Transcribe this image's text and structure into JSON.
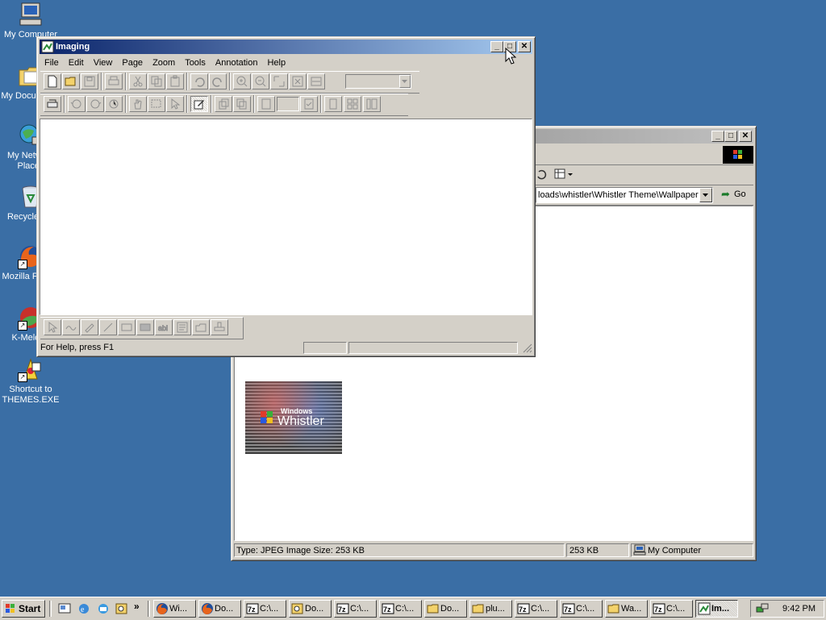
{
  "desktop": {
    "icons": [
      {
        "label": "My Computer"
      },
      {
        "label": "My Documents"
      },
      {
        "label": "My Network Places"
      },
      {
        "label": "Recycle Bin"
      },
      {
        "label": "Mozilla Firefox"
      },
      {
        "label": "K-Meleon"
      },
      {
        "label": "Shortcut to THEMES.EXE"
      }
    ]
  },
  "imaging": {
    "title": "Imaging",
    "menu": [
      "File",
      "Edit",
      "View",
      "Page",
      "Zoom",
      "Tools",
      "Annotation",
      "Help"
    ],
    "status": {
      "help": "For Help, press F1",
      "cell1": "",
      "cell2": ""
    }
  },
  "explorer": {
    "address_value": "loads\\whistler\\Whistler Theme\\Wallpaper",
    "go_label": "Go",
    "thumbnail": {
      "line1": "Windows",
      "line2": "Whistler"
    },
    "status": {
      "type": "Type: JPEG Image Size: 253 KB",
      "size": "253 KB",
      "zone": "My Computer"
    }
  },
  "taskbar": {
    "start_label": "Start",
    "tasks": [
      {
        "label": "Wi...",
        "icon": "firefox-icon"
      },
      {
        "label": "Do...",
        "icon": "firefox-icon"
      },
      {
        "label": "C:\\...",
        "icon": "7zip-icon"
      },
      {
        "label": "Do...",
        "icon": "search-icon"
      },
      {
        "label": "C:\\...",
        "icon": "7zip-icon"
      },
      {
        "label": "C:\\...",
        "icon": "7zip-icon"
      },
      {
        "label": "Do...",
        "icon": "folder-icon"
      },
      {
        "label": "plu...",
        "icon": "folder-icon"
      },
      {
        "label": "C:\\...",
        "icon": "7zip-icon"
      },
      {
        "label": "C:\\...",
        "icon": "7zip-icon"
      },
      {
        "label": "Wa...",
        "icon": "folder-icon"
      },
      {
        "label": "C:\\...",
        "icon": "7zip-icon"
      },
      {
        "label": "Im...",
        "icon": "imaging-icon"
      }
    ],
    "clock": "9:42 PM"
  }
}
